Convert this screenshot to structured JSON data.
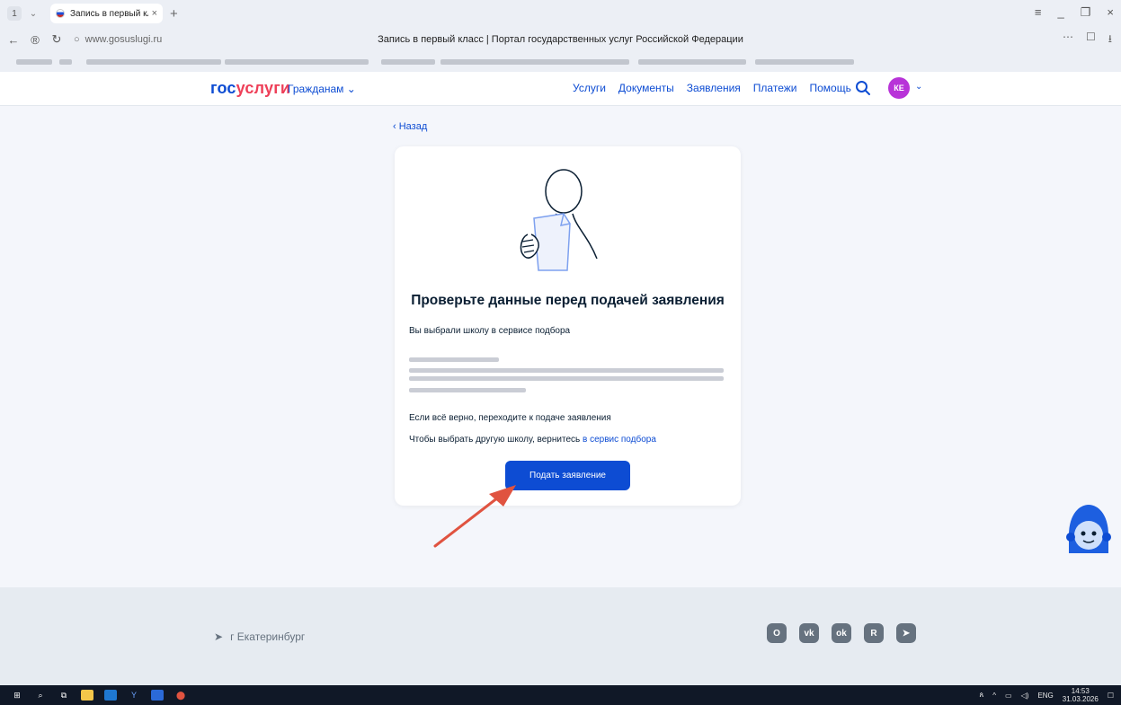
{
  "browser": {
    "tab_count": "1",
    "tab_title": "Запись в первый класс",
    "url": "www.gosuslugi.ru",
    "page_title": "Запись в первый класс | Портал государственных услуг Российской Федерации"
  },
  "header": {
    "logo_part1": "гос",
    "logo_part2": "услуги",
    "audience": "Гражданам",
    "nav": [
      "Услуги",
      "Документы",
      "Заявления",
      "Платежи",
      "Помощь"
    ],
    "avatar_initials": "КЕ"
  },
  "content": {
    "back_label": "Назад",
    "title": "Проверьте данные перед подачей заявления",
    "school_selected": "Вы выбрали школу в сервисе подбора",
    "confirm_text": "Если всё верно, переходите к подаче заявления",
    "other_school_text": "Чтобы выбрать другую школу, вернитесь",
    "other_school_link": "в сервис подбора",
    "submit_label": "Подать заявление"
  },
  "footer": {
    "city": "г Екатеринбург",
    "socials": [
      "odnoklassniki-o",
      "VK",
      "OK",
      "R",
      "telegram"
    ]
  },
  "taskbar": {
    "lang": "ENG",
    "time": "14:53",
    "date": "31.03.2026"
  },
  "colors": {
    "brand_blue": "#0d4cd3",
    "brand_red": "#ee3f58",
    "annotation_arrow": "#e05340"
  }
}
